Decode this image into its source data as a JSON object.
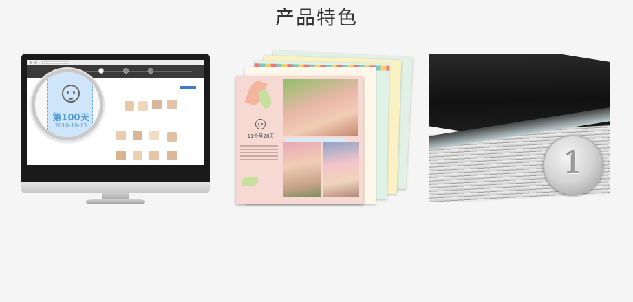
{
  "section": {
    "title": "产品特色"
  },
  "monitor": {
    "magnifier": {
      "day_label": "第100天",
      "date_label": "2010-10-13"
    }
  },
  "album": {
    "front_page": {
      "day_label": "11个月28天"
    }
  },
  "book": {
    "coin_value": "1"
  },
  "colors": {
    "background": "#f5f5f5",
    "magnifier_text": "#4f9ad6",
    "album_page": "#f7d9d3"
  }
}
